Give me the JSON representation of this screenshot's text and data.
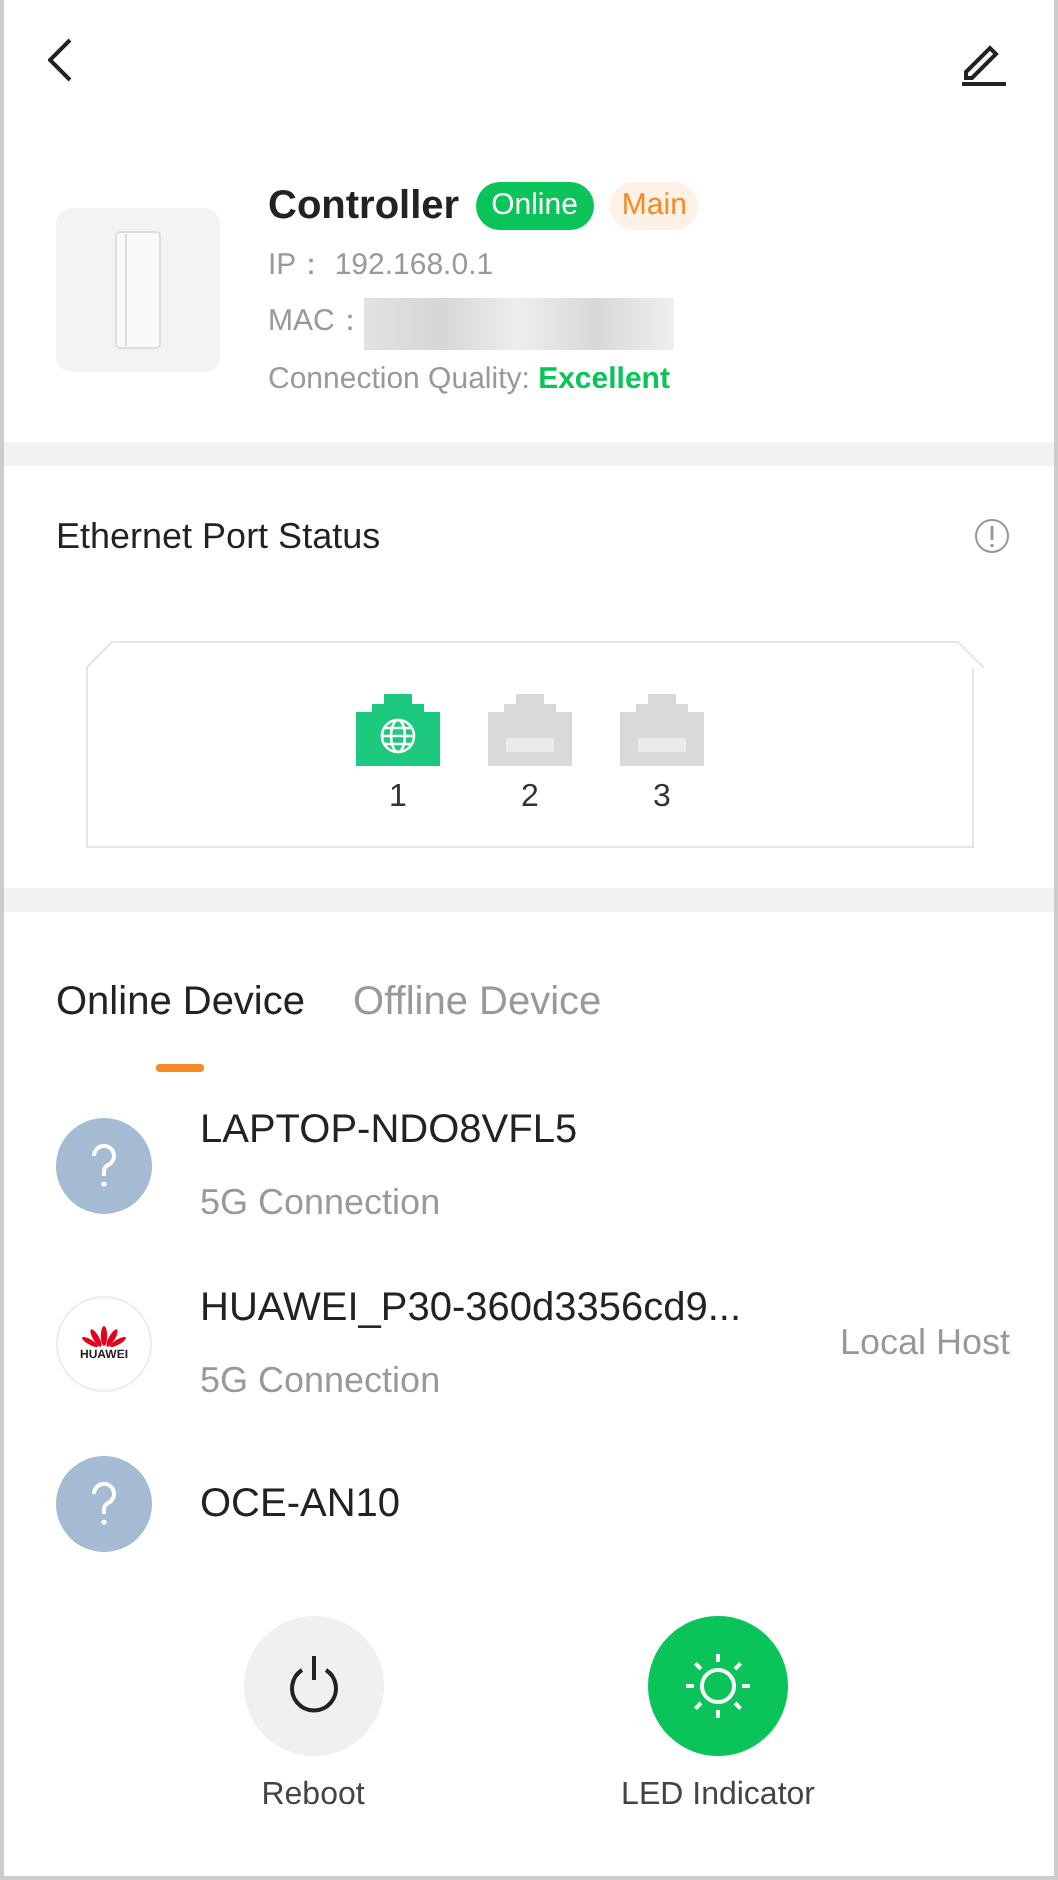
{
  "device": {
    "name": "Controller",
    "badges": [
      {
        "label": "Online",
        "kind": "status"
      },
      {
        "label": "Main",
        "kind": "role"
      }
    ],
    "ip_label": "IP：",
    "ip": "192.168.0.1",
    "mac_label": "MAC：",
    "quality_label": "Connection Quality: ",
    "quality": "Excellent"
  },
  "ports": {
    "title": "Ethernet Port Status",
    "items": [
      {
        "label": "1",
        "connected": true
      },
      {
        "label": "2",
        "connected": false
      },
      {
        "label": "3",
        "connected": false
      }
    ]
  },
  "tabs": [
    {
      "label": "Online Device",
      "selected": true
    },
    {
      "label": "Offline Device",
      "selected": false
    }
  ],
  "devices": [
    {
      "name": "LAPTOP-NDO8VFL5",
      "subtitle": "5G Connection",
      "kind": "unknown"
    },
    {
      "name": "HUAWEI_P30-360d3356cd9...",
      "subtitle": "5G Connection",
      "kind": "brand",
      "logo_text": "HUAWEI",
      "tag": "Local Host"
    },
    {
      "name": "OCE-AN10",
      "kind": "unknown"
    }
  ],
  "actions": [
    {
      "label": "Reboot",
      "kind": "power",
      "on": false
    },
    {
      "label": "LED Indicator",
      "kind": "led",
      "on": true
    }
  ]
}
